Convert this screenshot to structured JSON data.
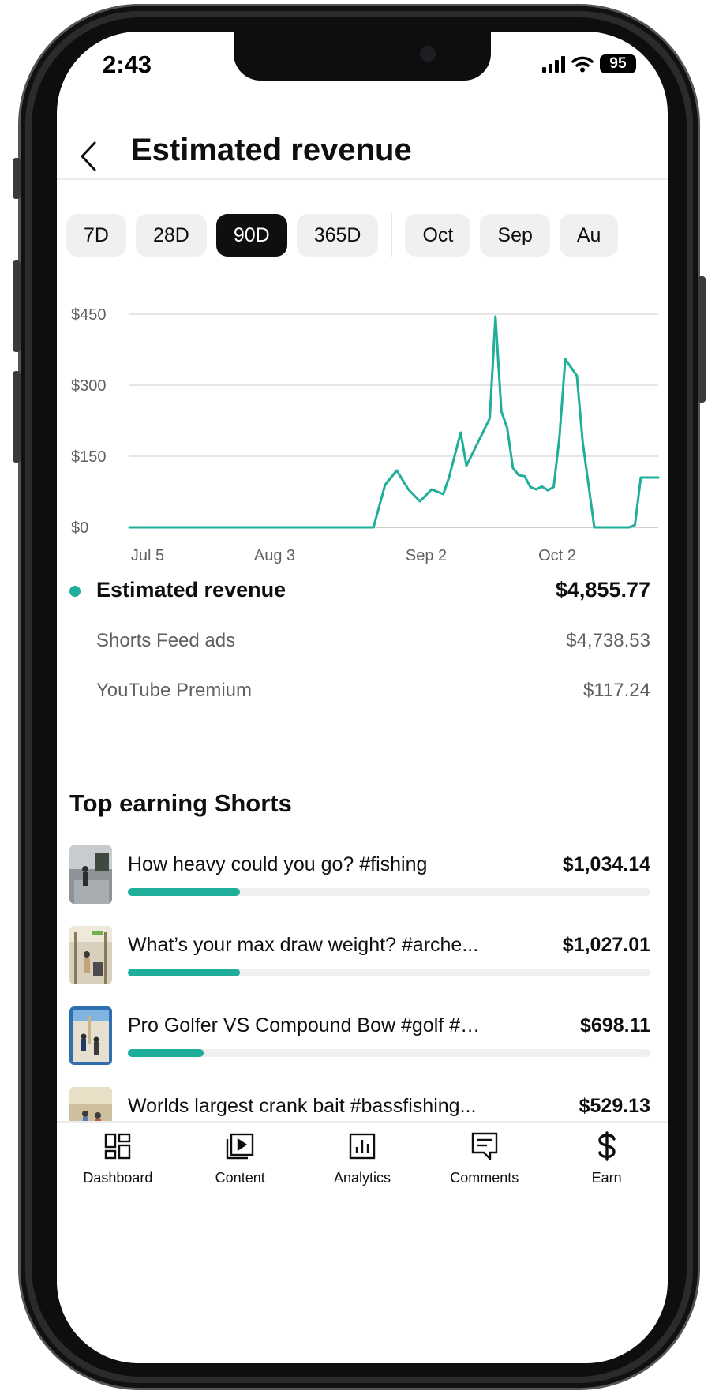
{
  "status_bar": {
    "time": "2:43",
    "battery": "95"
  },
  "header": {
    "title": "Estimated revenue"
  },
  "period_chips": [
    {
      "label": "7D",
      "active": false
    },
    {
      "label": "28D",
      "active": false
    },
    {
      "label": "90D",
      "active": true
    },
    {
      "label": "365D",
      "active": false
    },
    {
      "label": "Oct",
      "active": false
    },
    {
      "label": "Sep",
      "active": false
    },
    {
      "label": "Au",
      "active": false
    }
  ],
  "chart_data": {
    "type": "line",
    "x_tick_labels": [
      "Jul 5",
      "Aug 3",
      "Sep 2",
      "Oct 2"
    ],
    "y_tick_labels": [
      "$0",
      "$150",
      "$300",
      "$450"
    ],
    "ylim": [
      0,
      450
    ],
    "grid": true,
    "color": "#1fae9a",
    "series": [
      {
        "x": [
          0,
          42,
          44,
          46,
          48,
          50,
          52,
          54,
          55,
          57,
          58,
          60,
          62,
          63,
          64,
          65,
          66,
          67,
          68,
          69,
          70,
          71,
          72,
          73,
          74,
          75,
          77,
          78,
          80,
          81,
          83,
          84,
          86,
          87,
          88,
          89,
          90,
          91
        ],
        "values": [
          0,
          0,
          90,
          120,
          80,
          55,
          80,
          70,
          105,
          200,
          130,
          180,
          230,
          445,
          245,
          210,
          125,
          110,
          108,
          85,
          80,
          86,
          78,
          85,
          190,
          355,
          320,
          180,
          0,
          0,
          0,
          0,
          0,
          5,
          105,
          105,
          105,
          105
        ]
      }
    ]
  },
  "summary": {
    "total": {
      "label": "Estimated revenue",
      "value": "$4,855.77"
    },
    "rows": [
      {
        "label": "Shorts Feed ads",
        "value": "$4,738.53"
      },
      {
        "label": "YouTube Premium",
        "value": "$117.24"
      }
    ]
  },
  "top_shorts": {
    "title": "Top earning Shorts",
    "items": [
      {
        "title": "How heavy could you go? #fishing",
        "value": "$1,034.14",
        "share": 0.215
      },
      {
        "title": "What’s your max draw weight? #arche...",
        "value": "$1,027.01",
        "share": 0.215
      },
      {
        "title": "Pro Golfer VS Compound Bow #golf #ar...",
        "value": "$698.11",
        "share": 0.145
      },
      {
        "title": "Worlds largest crank bait #bassfishing...",
        "value": "$529.13",
        "share": 0.11
      }
    ]
  },
  "nav": [
    {
      "label": "Dashboard",
      "icon": "dashboard-icon"
    },
    {
      "label": "Content",
      "icon": "content-icon"
    },
    {
      "label": "Analytics",
      "icon": "analytics-icon"
    },
    {
      "label": "Comments",
      "icon": "comments-icon"
    },
    {
      "label": "Earn",
      "icon": "earn-icon"
    }
  ]
}
